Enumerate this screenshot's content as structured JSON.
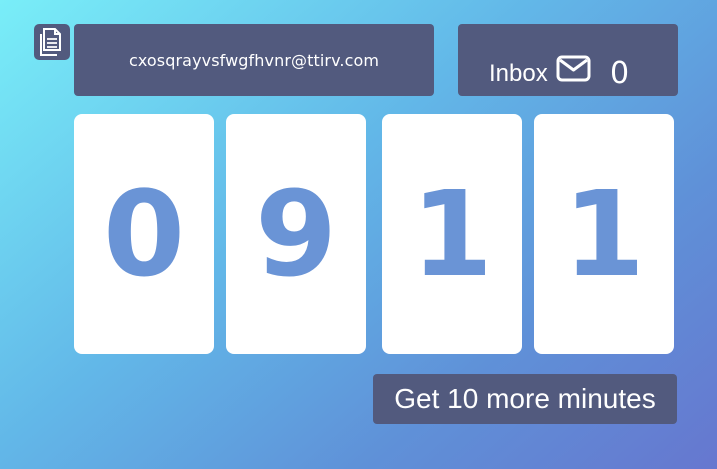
{
  "email": {
    "address": "cxosqrayvsfwgfhvnr@ttirv.com",
    "copy_icon": "copy-document-icon"
  },
  "inbox": {
    "label": "Inbox",
    "icon": "envelope-icon",
    "count": "0"
  },
  "timer": {
    "digits": [
      "0",
      "9",
      "1",
      "1"
    ]
  },
  "actions": {
    "more_minutes_label": "Get 10 more minutes"
  },
  "colors": {
    "panel": "#525a7e",
    "digit": "#6a94d6",
    "card": "#ffffff",
    "gradient_start": "#79eef8",
    "gradient_end": "#6677cf"
  }
}
